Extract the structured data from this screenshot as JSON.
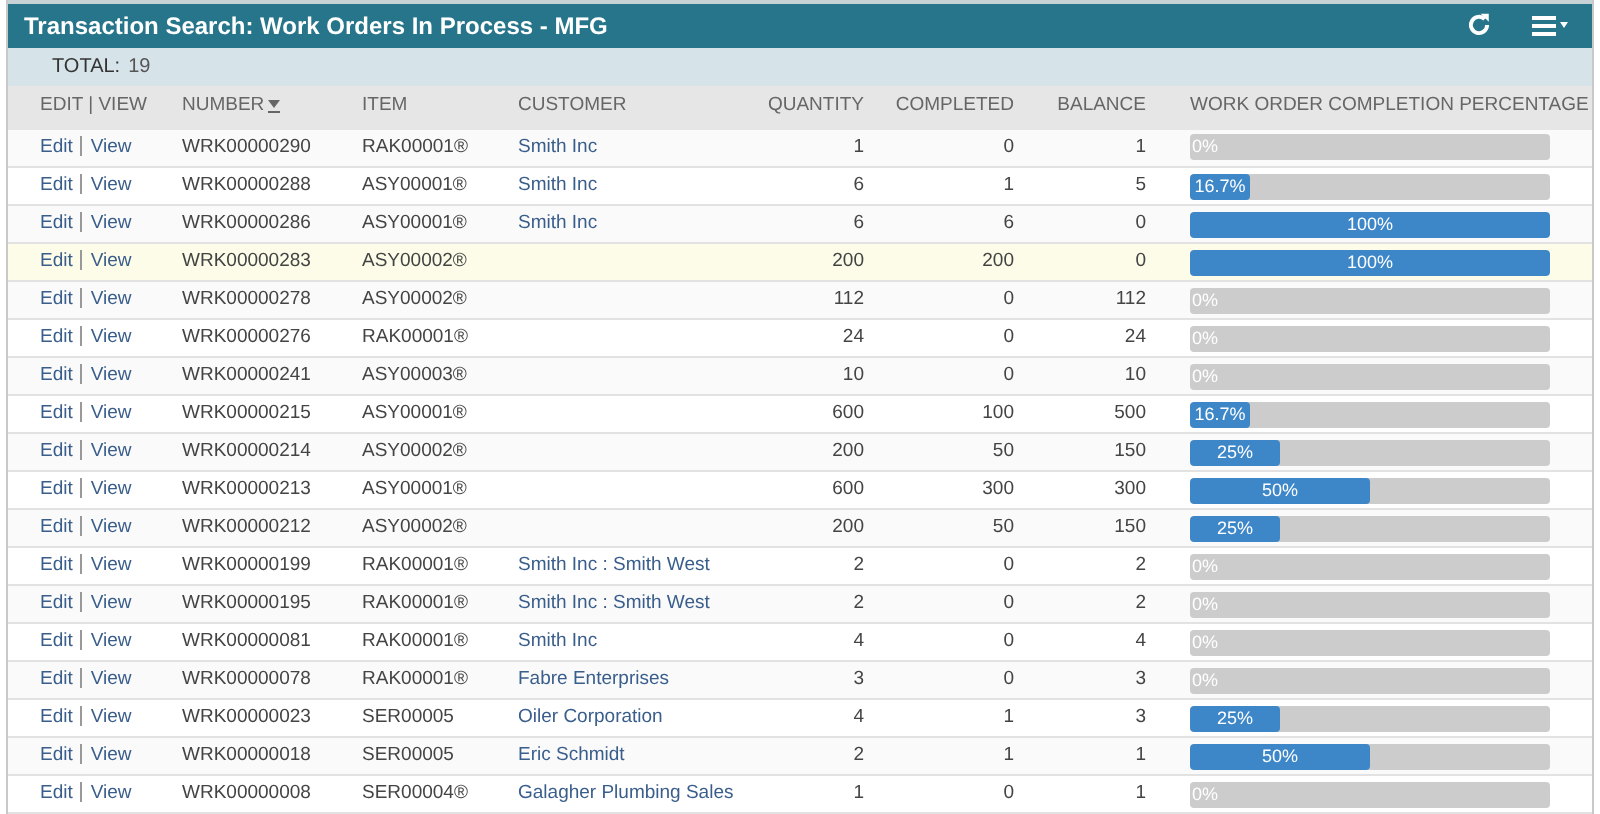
{
  "header": {
    "title": "Transaction Search: Work Orders In Process - MFG"
  },
  "total": {
    "label": "TOTAL:",
    "value": "19"
  },
  "columns": [
    {
      "label": "EDIT | VIEW",
      "sorted": false
    },
    {
      "label": "NUMBER",
      "sorted": true
    },
    {
      "label": "ITEM",
      "sorted": false
    },
    {
      "label": "CUSTOMER",
      "sorted": false
    },
    {
      "label": "QUANTITY",
      "sorted": false
    },
    {
      "label": "COMPLETED",
      "sorted": false
    },
    {
      "label": "BALANCE",
      "sorted": false
    },
    {
      "label": "WORK ORDER COMPLETION PERCENTAGE",
      "sorted": false
    }
  ],
  "rows": [
    {
      "edit": "Edit",
      "view": "View",
      "number": "WRK00000290",
      "item": "RAK00001®",
      "customer": "Smith Inc",
      "quantity": "1",
      "completed": "0",
      "balance": "1",
      "level": 0,
      "percent": "0%",
      "selected": false
    },
    {
      "edit": "Edit",
      "view": "View",
      "number": "WRK00000288",
      "item": "ASY00001®",
      "customer": "Smith Inc",
      "quantity": "6",
      "completed": "1",
      "balance": "5",
      "level": 0.167,
      "percent": "16.7%",
      "selected": false
    },
    {
      "edit": "Edit",
      "view": "View",
      "number": "WRK00000286",
      "item": "ASY00001®",
      "customer": "Smith Inc",
      "quantity": "6",
      "completed": "6",
      "balance": "0",
      "level": 1,
      "percent": "100%",
      "selected": false
    },
    {
      "edit": "Edit",
      "view": "View",
      "number": "WRK00000283",
      "item": "ASY00002®",
      "quantity": "200",
      "completed": "200",
      "balance": "0",
      "level": 1,
      "percent": "100%",
      "selected": true
    },
    {
      "edit": "Edit",
      "view": "View",
      "number": "WRK00000278",
      "item": "ASY00002®",
      "quantity": "112",
      "completed": "0",
      "balance": "112",
      "level": 0,
      "percent": "0%",
      "selected": false
    },
    {
      "edit": "Edit",
      "view": "View",
      "number": "WRK00000276",
      "item": "RAK00001®",
      "quantity": "24",
      "completed": "0",
      "balance": "24",
      "level": 0,
      "percent": "0%",
      "selected": false
    },
    {
      "edit": "Edit",
      "view": "View",
      "number": "WRK00000241",
      "item": "ASY00003®",
      "quantity": "10",
      "completed": "0",
      "balance": "10",
      "level": 0,
      "percent": "0%",
      "selected": false
    },
    {
      "edit": "Edit",
      "view": "View",
      "number": "WRK00000215",
      "item": "ASY00001®",
      "quantity": "600",
      "completed": "100",
      "balance": "500",
      "level": 0.167,
      "percent": "16.7%",
      "selected": false
    },
    {
      "edit": "Edit",
      "view": "View",
      "number": "WRK00000214",
      "item": "ASY00002®",
      "quantity": "200",
      "completed": "50",
      "balance": "150",
      "level": 0.25,
      "percent": "25%",
      "selected": false
    },
    {
      "edit": "Edit",
      "view": "View",
      "number": "WRK00000213",
      "item": "ASY00001®",
      "quantity": "600",
      "completed": "300",
      "balance": "300",
      "level": 0.5,
      "percent": "50%",
      "selected": false
    },
    {
      "edit": "Edit",
      "view": "View",
      "number": "WRK00000212",
      "item": "ASY00002®",
      "quantity": "200",
      "completed": "50",
      "balance": "150",
      "level": 0.25,
      "percent": "25%",
      "selected": false
    },
    {
      "edit": "Edit",
      "view": "View",
      "number": "WRK00000199",
      "item": "RAK00001®",
      "customer": "Smith Inc : Smith West",
      "quantity": "2",
      "completed": "0",
      "balance": "2",
      "level": 0,
      "percent": "0%",
      "selected": false
    },
    {
      "edit": "Edit",
      "view": "View",
      "number": "WRK00000195",
      "item": "RAK00001®",
      "customer": "Smith Inc : Smith West",
      "quantity": "2",
      "completed": "0",
      "balance": "2",
      "level": 0,
      "percent": "0%",
      "selected": false
    },
    {
      "edit": "Edit",
      "view": "View",
      "number": "WRK00000081",
      "item": "RAK00001®",
      "customer": "Smith Inc",
      "quantity": "4",
      "completed": "0",
      "balance": "4",
      "level": 0,
      "percent": "0%",
      "selected": false
    },
    {
      "edit": "Edit",
      "view": "View",
      "number": "WRK00000078",
      "item": "RAK00001®",
      "customer": "Fabre Enterprises",
      "quantity": "3",
      "completed": "0",
      "balance": "3",
      "level": 0,
      "percent": "0%",
      "selected": false
    },
    {
      "edit": "Edit",
      "view": "View",
      "number": "WRK00000023",
      "item": "SER00005",
      "customer": "Oiler Corporation",
      "quantity": "4",
      "completed": "1",
      "balance": "3",
      "level": 0.25,
      "percent": "25%",
      "selected": false
    },
    {
      "edit": "Edit",
      "view": "View",
      "number": "WRK00000018",
      "item": "SER00005",
      "customer": "Eric Schmidt",
      "quantity": "2",
      "completed": "1",
      "balance": "1",
      "level": 0.5,
      "percent": "50%",
      "selected": false
    },
    {
      "edit": "Edit",
      "view": "View",
      "number": "WRK00000008",
      "item": "SER00004®",
      "customer": "Galagher Plumbing Sales",
      "quantity": "1",
      "completed": "0",
      "balance": "1",
      "level": 0,
      "percent": "0%",
      "selected": false
    }
  ]
}
